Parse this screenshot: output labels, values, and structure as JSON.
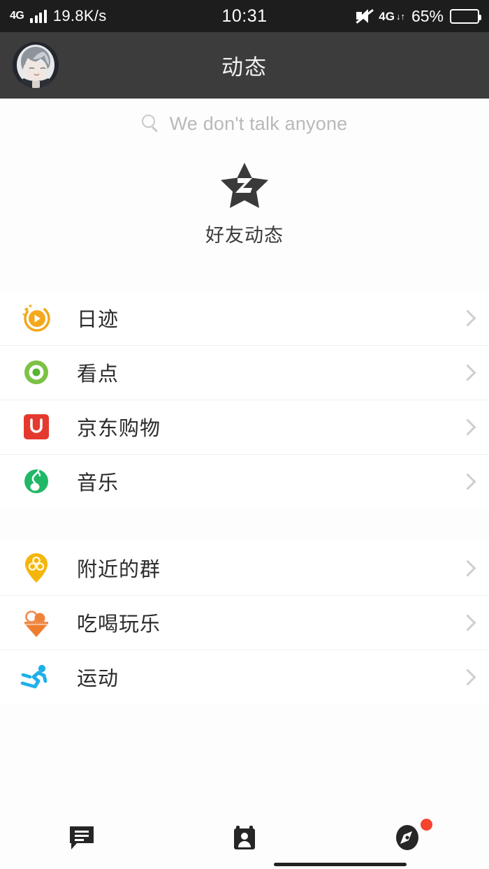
{
  "status_bar": {
    "network_label": "4G",
    "speed": "19.8K/s",
    "clock": "10:31",
    "mute_icon": "mute-speaker-icon",
    "data_icon": "4g-data-transfer-icon",
    "data_label": "4G",
    "battery_percent": "65%",
    "battery_level": 65
  },
  "title_bar": {
    "avatar": "user-avatar",
    "title": "动态"
  },
  "search": {
    "icon": "search-icon",
    "placeholder": "We don't talk anyone",
    "value": ""
  },
  "feature": {
    "icon": "qzone-star-icon",
    "label": "好友动态"
  },
  "list_groups": [
    {
      "items": [
        {
          "icon": "daily-track-play-icon",
          "label": "日迹",
          "color": "#f2a809",
          "chevron": "chevron-right-icon"
        },
        {
          "icon": "kandian-eye-icon",
          "label": "看点",
          "color": "#7ac943",
          "chevron": "chevron-right-icon"
        },
        {
          "icon": "jd-shopping-icon",
          "label": "京东购物",
          "color": "#e4393c",
          "chevron": "chevron-right-icon"
        },
        {
          "icon": "music-note-icon",
          "label": "音乐",
          "color": "#1fb563",
          "chevron": "chevron-right-icon"
        }
      ]
    },
    {
      "items": [
        {
          "icon": "nearby-group-pin-icon",
          "label": "附近的群",
          "color": "#f5b50a",
          "chevron": "chevron-right-icon"
        },
        {
          "icon": "ice-cream-icon",
          "label": "吃喝玩乐",
          "color": "#f07c32",
          "chevron": "chevron-right-icon"
        },
        {
          "icon": "sports-runner-icon",
          "label": "运动",
          "color": "#23b0e8",
          "chevron": "chevron-right-icon"
        }
      ]
    }
  ],
  "tab_bar": {
    "tabs": [
      {
        "icon": "chat-bubble-icon",
        "active": false,
        "badge": false
      },
      {
        "icon": "contacts-card-icon",
        "active": false,
        "badge": false
      },
      {
        "icon": "compass-discover-icon",
        "active": true,
        "badge": true
      }
    ],
    "badge_color": "#f4442e"
  },
  "colors": {
    "status_bar_bg": "#1d1d1d",
    "title_bar_bg": "#3c3c3c",
    "page_bg": "#fdfdfd",
    "row_bg": "#ffffff",
    "divider": "#efefef",
    "text_primary": "#2b2b2b",
    "text_placeholder": "#b9b9b9"
  }
}
